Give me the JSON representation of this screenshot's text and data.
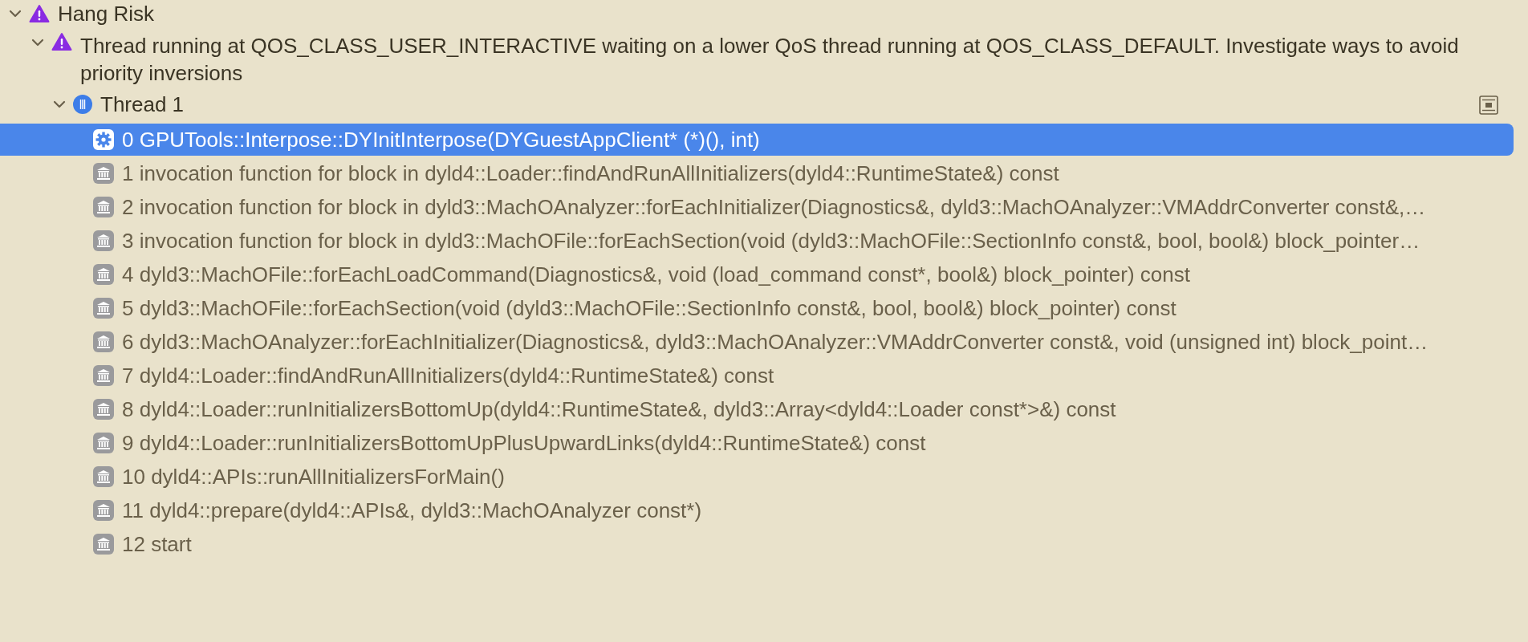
{
  "issues": [
    {
      "title": "Hang Risk",
      "expanded": true,
      "children": [
        {
          "title": "Thread running at QOS_CLASS_USER_INTERACTIVE waiting on a lower QoS thread running at QOS_CLASS_DEFAULT. Investigate ways to avoid priority inversions",
          "expanded": true,
          "threads": [
            {
              "title": "Thread 1",
              "expanded": true,
              "frames": [
                {
                  "label": "0 GPUTools::Interpose::DYInitInterpose(DYGuestAppClient* (*)(), int)",
                  "kind": "user",
                  "selected": true
                },
                {
                  "label": "1 invocation function for block in dyld4::Loader::findAndRunAllInitializers(dyld4::RuntimeState&) const",
                  "kind": "library",
                  "selected": false
                },
                {
                  "label": "2 invocation function for block in dyld3::MachOAnalyzer::forEachInitializer(Diagnostics&, dyld3::MachOAnalyzer::VMAddrConverter const&,…",
                  "kind": "library",
                  "selected": false
                },
                {
                  "label": "3 invocation function for block in dyld3::MachOFile::forEachSection(void (dyld3::MachOFile::SectionInfo const&, bool, bool&) block_pointer…",
                  "kind": "library",
                  "selected": false
                },
                {
                  "label": "4 dyld3::MachOFile::forEachLoadCommand(Diagnostics&, void (load_command const*, bool&) block_pointer) const",
                  "kind": "library",
                  "selected": false
                },
                {
                  "label": "5 dyld3::MachOFile::forEachSection(void (dyld3::MachOFile::SectionInfo const&, bool, bool&) block_pointer) const",
                  "kind": "library",
                  "selected": false
                },
                {
                  "label": "6 dyld3::MachOAnalyzer::forEachInitializer(Diagnostics&, dyld3::MachOAnalyzer::VMAddrConverter const&, void (unsigned int) block_point…",
                  "kind": "library",
                  "selected": false
                },
                {
                  "label": "7 dyld4::Loader::findAndRunAllInitializers(dyld4::RuntimeState&) const",
                  "kind": "library",
                  "selected": false
                },
                {
                  "label": "8 dyld4::Loader::runInitializersBottomUp(dyld4::RuntimeState&, dyld3::Array<dyld4::Loader const*>&) const",
                  "kind": "library",
                  "selected": false
                },
                {
                  "label": "9 dyld4::Loader::runInitializersBottomUpPlusUpwardLinks(dyld4::RuntimeState&) const",
                  "kind": "library",
                  "selected": false
                },
                {
                  "label": "10 dyld4::APIs::runAllInitializersForMain()",
                  "kind": "library",
                  "selected": false
                },
                {
                  "label": "11 dyld4::prepare(dyld4::APIs&, dyld3::MachOAnalyzer const*)",
                  "kind": "library",
                  "selected": false
                },
                {
                  "label": "12 start",
                  "kind": "library",
                  "selected": false
                }
              ]
            }
          ]
        }
      ]
    }
  ]
}
